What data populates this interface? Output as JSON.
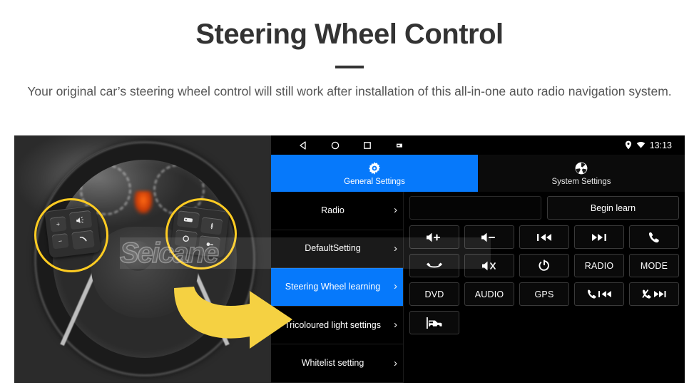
{
  "header": {
    "title": "Steering Wheel Control",
    "subtitle": "Your original car’s steering wheel control will still work after installation of this all-in-one auto radio navigation system."
  },
  "photo": {
    "watermark": "Seicane",
    "alt": "Car steering wheel with two yellow circled control pads and a yellow arrow"
  },
  "head_unit": {
    "statusbar": {
      "nav": [
        {
          "name": "back-icon",
          "label": "Back"
        },
        {
          "name": "home-icon",
          "label": "Home"
        },
        {
          "name": "recents-icon",
          "label": "Recents"
        },
        {
          "name": "screenshot-icon",
          "label": "Screenshot"
        }
      ],
      "location_icon": "location-pin-icon",
      "wifi_icon": "wifi-icon",
      "time": "13:13"
    },
    "tabs": [
      {
        "label": "General Settings",
        "icon": "gear-icon",
        "active": true
      },
      {
        "label": "System Settings",
        "icon": "system-logo-icon",
        "active": false
      }
    ],
    "menu": [
      {
        "label": "Radio",
        "selected": false
      },
      {
        "label": "DefaultSetting",
        "selected": false
      },
      {
        "label": "Steering Wheel learning",
        "selected": true
      },
      {
        "label": "Tricoloured light settings",
        "selected": false
      },
      {
        "label": "Whitelist setting",
        "selected": false
      }
    ],
    "panel": {
      "display_field_value": "",
      "begin_learn_label": "Begin learn",
      "buttons": [
        {
          "label": "",
          "icon": "volume-up-icon"
        },
        {
          "label": "",
          "icon": "volume-down-icon"
        },
        {
          "label": "",
          "icon": "previous-track-icon"
        },
        {
          "label": "",
          "icon": "next-track-icon"
        },
        {
          "label": "",
          "icon": "call-answer-icon"
        },
        {
          "label": "",
          "icon": "call-hangup-icon"
        },
        {
          "label": "",
          "icon": "mute-icon"
        },
        {
          "label": "",
          "icon": "power-icon"
        },
        {
          "label": "RADIO",
          "icon": ""
        },
        {
          "label": "MODE",
          "icon": ""
        },
        {
          "label": "DVD",
          "icon": ""
        },
        {
          "label": "AUDIO",
          "icon": ""
        },
        {
          "label": "GPS",
          "icon": ""
        },
        {
          "label": "",
          "icon": "call-previous-icon"
        },
        {
          "label": "",
          "icon": "callend-next-icon"
        },
        {
          "label": "",
          "icon": "car-info-icon"
        }
      ]
    }
  },
  "colors": {
    "accent_blue": "#0679FB",
    "highlight_yellow": "#FFCC22",
    "arrow_yellow": "#F5D142",
    "title_gray": "#333333",
    "panel_black": "#000000"
  }
}
